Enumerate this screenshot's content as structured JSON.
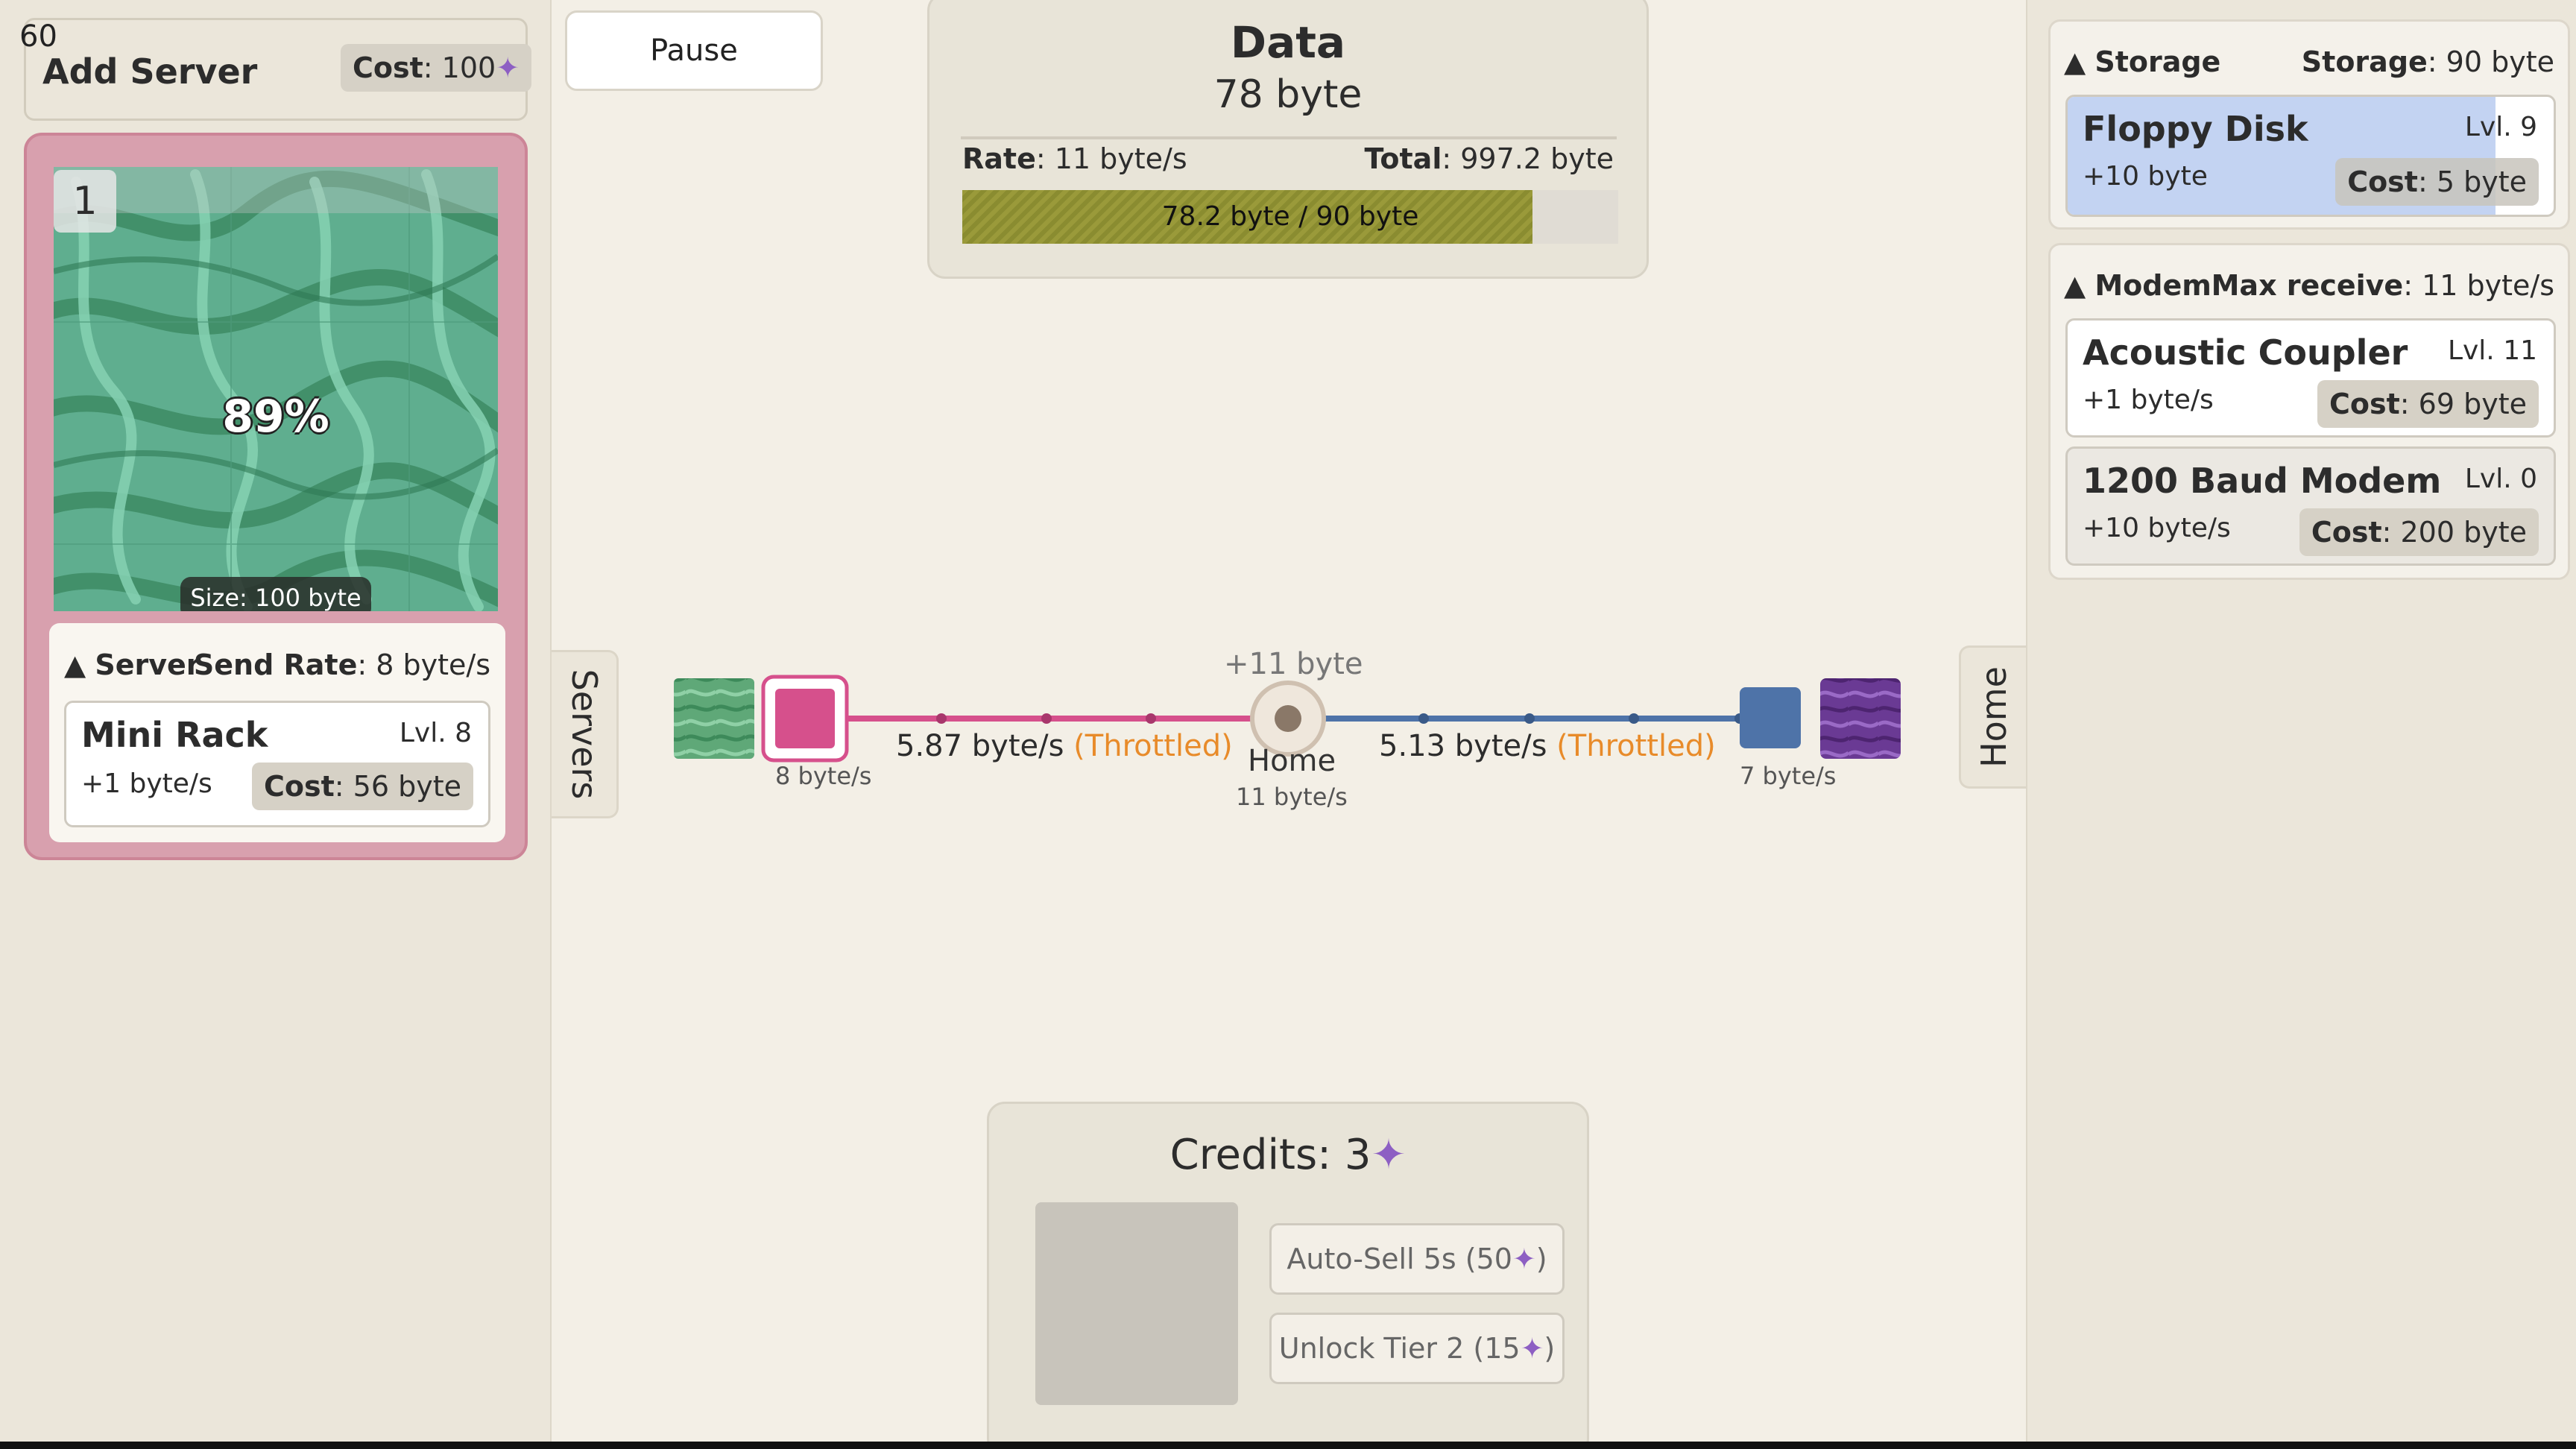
{
  "fps": "60",
  "left": {
    "add_server": {
      "title": "Add Server",
      "cost_label": "Cost",
      "cost_value": ": 100",
      "cost_icon": "✦"
    },
    "server": {
      "index": "1",
      "progress_pct": "89%",
      "size": "Size: 100 byte",
      "section": {
        "arrow": "▲",
        "title": "Server",
        "stat_label": "Send Rate",
        "stat_value": ": 8 byte/s"
      },
      "upgrade": {
        "name": "Mini Rack",
        "level": "Lvl. 8",
        "effect": "+1 byte/s",
        "cost_label": "Cost",
        "cost_value": ": 56 byte"
      }
    }
  },
  "controls": {
    "pause": "Pause"
  },
  "data_panel": {
    "title": "Data",
    "amount": "78 byte",
    "rate_label": "Rate",
    "rate_value": ": 11 byte/s",
    "total_label": "Total",
    "total_value": ": 997.2 byte",
    "bar_text": "78.2 byte / 90 byte",
    "bar_fraction": 0.869
  },
  "tabs": {
    "servers": "Servers",
    "home": "Home"
  },
  "network": {
    "gain": "+11 byte",
    "left_link_rate": "5.87 byte/s",
    "left_link_status": "(Throttled)",
    "right_link_rate": "5.13 byte/s",
    "right_link_status": "(Throttled)",
    "server_rate": "8 byte/s",
    "home_label": "Home",
    "home_rate": "11 byte/s",
    "right_node_rate": "7 byte/s",
    "colors": {
      "left_link": "#d6508c",
      "right_link": "#4e73a8",
      "home_node": "#8a7868"
    }
  },
  "credits": {
    "title": "Credits: 3",
    "icon": "✦",
    "auto_sell": "Auto-Sell 5s (50",
    "unlock_tier": "Unlock Tier 2 (15",
    "close_paren": ")"
  },
  "right": {
    "storage": {
      "arrow": "▲",
      "title": "Storage",
      "stat_label": "Storage",
      "stat_value": ": 90 byte",
      "items": [
        {
          "name": "Floppy Disk",
          "level": "Lvl. 9",
          "effect": "+10 byte",
          "cost_label": "Cost",
          "cost_value": ": 5 byte",
          "progress_fraction": 0.88
        }
      ]
    },
    "modem": {
      "arrow": "▲",
      "title": "Modem",
      "stat_label": "Max receive",
      "stat_value": ": 11 byte/s",
      "items": [
        {
          "name": "Acoustic Coupler",
          "level": "Lvl. 11",
          "effect": "+1 byte/s",
          "cost_label": "Cost",
          "cost_value": ": 69 byte"
        },
        {
          "name": "1200 Baud Modem",
          "level": "Lvl. 0",
          "effect": "+10 byte/s",
          "cost_label": "Cost",
          "cost_value": ": 200 byte"
        }
      ]
    }
  }
}
